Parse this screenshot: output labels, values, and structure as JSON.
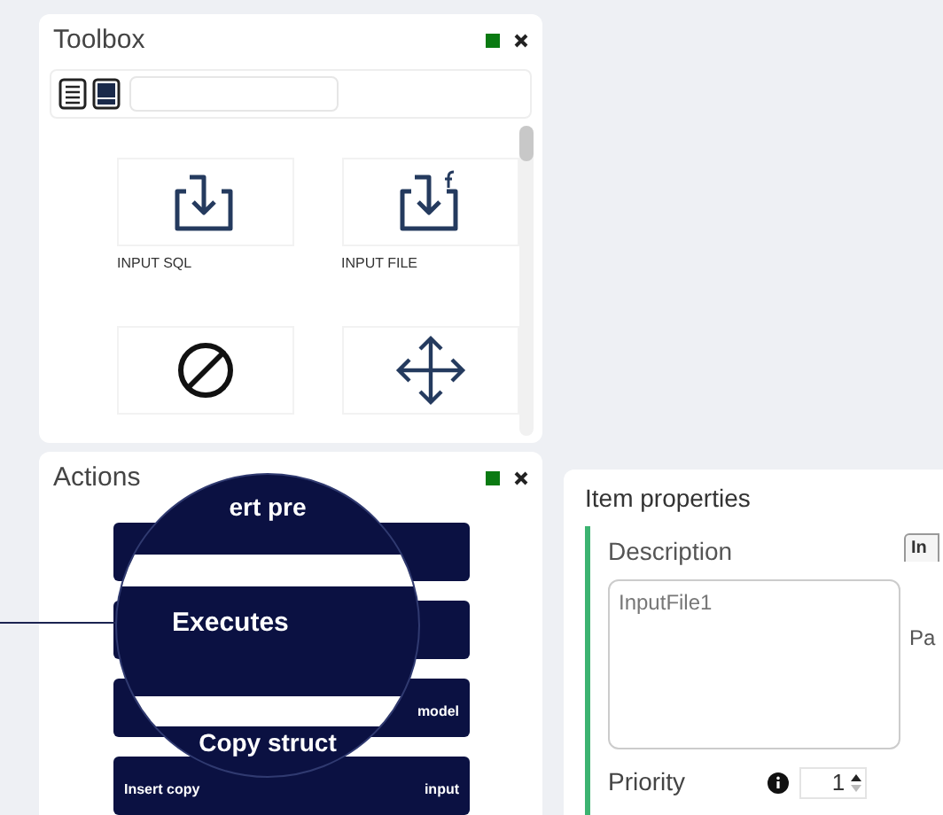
{
  "toolbox": {
    "title": "Toolbox",
    "views": [
      {
        "kind": "list"
      },
      {
        "kind": "tiles"
      }
    ],
    "tools": [
      {
        "kind": "input",
        "label": "INPUT SQL"
      },
      {
        "kind": "input-file",
        "label": "INPUT FILE"
      },
      {
        "kind": "prohibit"
      },
      {
        "kind": "move"
      }
    ]
  },
  "actions": {
    "title": "Actions",
    "buttons": [
      {
        "kind": "action"
      },
      {
        "kind": "action"
      },
      {
        "kind": "action",
        "texts": [
          "model"
        ]
      },
      {
        "kind": "action",
        "texts": [
          "Insert copy",
          "input"
        ]
      }
    ]
  },
  "magnifier": {
    "texts": [
      "ert pre",
      "Executes",
      "Copy struct"
    ]
  },
  "item_properties": {
    "title": "Item properties",
    "description_label": "Description",
    "description_value": "InputFile1",
    "priority_label": "Priority",
    "priority_value": "1",
    "tab": "In",
    "side_label": "Pa"
  }
}
